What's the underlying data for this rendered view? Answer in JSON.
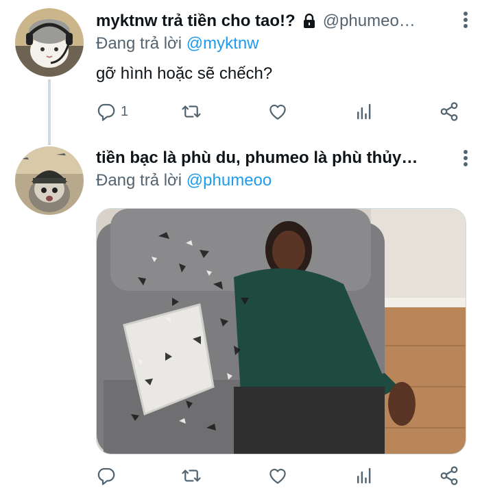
{
  "tweets": [
    {
      "display_name": "myktnw trả tiền cho tao!?",
      "handle": "@phumeo…",
      "protected_icon": "lock-icon",
      "reply_prefix": "Đang trả lời",
      "reply_mention": "@myktnw",
      "text": "gỡ hình hoặc sẽ chếch?",
      "reply_count": "1",
      "avatar": "cat-with-headset-avatar"
    },
    {
      "display_name": "tiền bạc là phù du, phumeo là phù thủy…",
      "reply_prefix": "Đang trả lời",
      "reply_mention": "@phumeoo",
      "media": "person-disintegrating-meme-photo",
      "avatar": "cat-with-helmet-avatar"
    }
  ],
  "icons": {
    "reply": "reply-icon",
    "retweet": "retweet-icon",
    "like": "heart-icon",
    "stats": "bar-chart-icon",
    "share": "share-icon",
    "more": "more-vertical-icon"
  },
  "colors": {
    "text": "#0f1419",
    "secondary": "#536471",
    "link": "#1d9bf0",
    "thread_line": "#cfd9de"
  }
}
